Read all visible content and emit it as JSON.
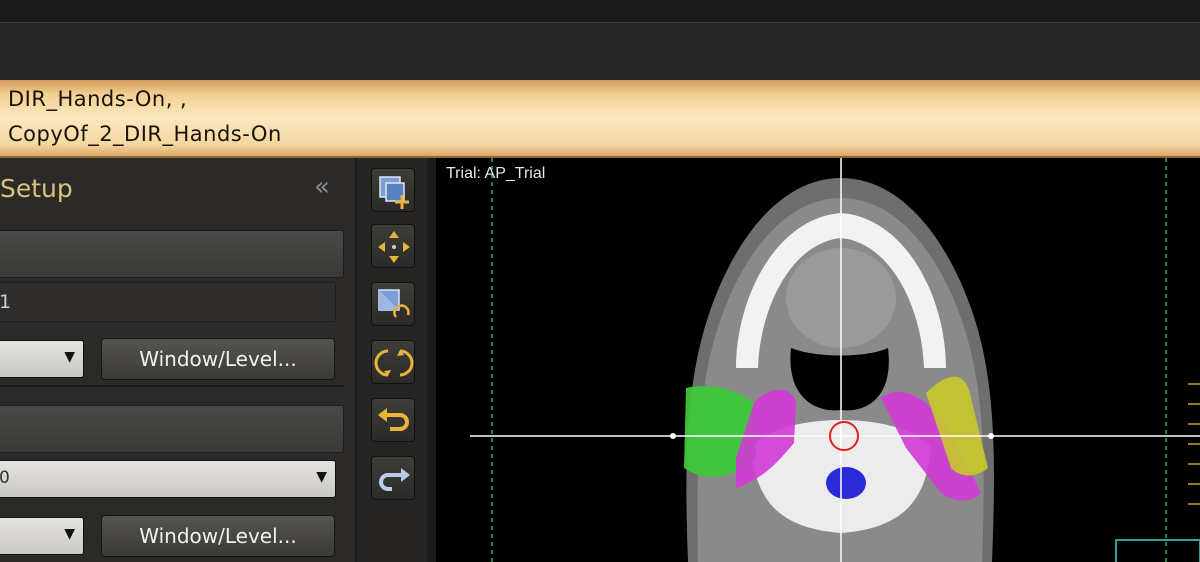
{
  "banner": {
    "line1": "DIR_Hands-On, ,",
    "line2": "CopyOf_2_DIR_Hands-On"
  },
  "panel": {
    "title": "Setup",
    "field1_value": "1",
    "select1_value": "",
    "window_level_1": "Window/Level...",
    "select2_value": "0",
    "window_level_2": "Window/Level..."
  },
  "tools": [
    {
      "icon": "add-window-icon"
    },
    {
      "icon": "pan-arrows-icon"
    },
    {
      "icon": "rotate-window-icon"
    },
    {
      "icon": "refresh-icon"
    },
    {
      "icon": "undo-icon"
    },
    {
      "icon": "redo-icon"
    }
  ],
  "viewer": {
    "trial_label": "Trial: AP_Trial"
  },
  "colors": {
    "banner_bg": "#f4d9a4",
    "panel_title": "#d9c27a",
    "tool_accent": "#e8b53a",
    "tool_blue": "#7a9fd6",
    "crosshair": "#ffffff",
    "guide_line": "#2fae4a",
    "structure_green": "#3ec83a",
    "structure_magenta": "#d23ad6",
    "structure_yellow": "#c8c82a",
    "structure_blue": "#2a2ad6",
    "marker_red": "#e02020"
  }
}
